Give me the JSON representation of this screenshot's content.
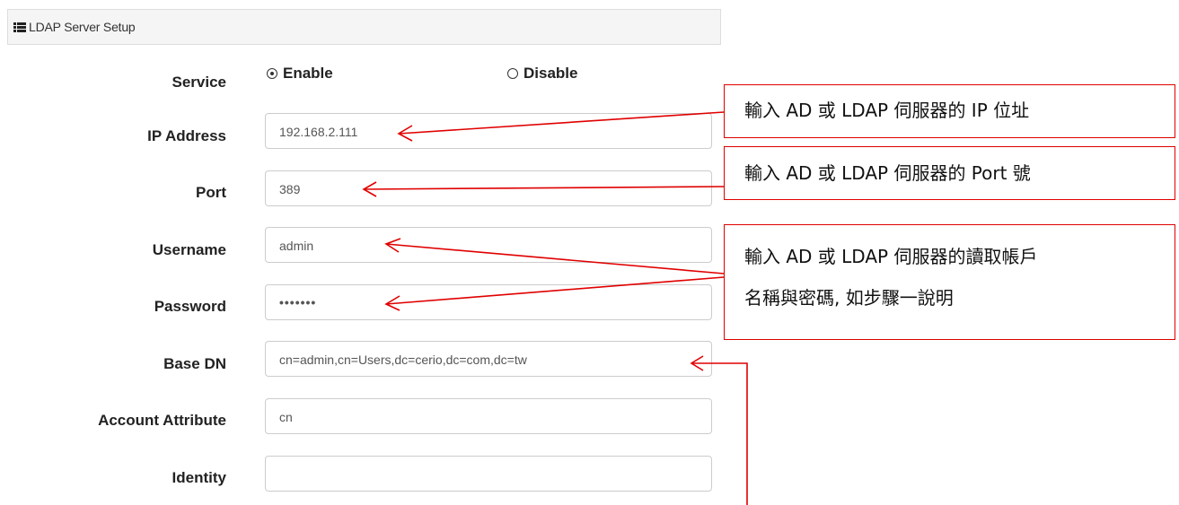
{
  "panel": {
    "title": "LDAP Server Setup"
  },
  "form": {
    "service": {
      "label": "Service",
      "options": [
        "Enable",
        "Disable"
      ],
      "selected": "Enable"
    },
    "ip_address": {
      "label": "IP Address",
      "value": "192.168.2.111"
    },
    "port": {
      "label": "Port",
      "value": "389"
    },
    "username": {
      "label": "Username",
      "value": "admin"
    },
    "password": {
      "label": "Password",
      "value": "•••••••"
    },
    "base_dn": {
      "label": "Base DN",
      "value": "cn=admin,cn=Users,dc=cerio,dc=com,dc=tw"
    },
    "account_attribute": {
      "label": "Account Attribute",
      "value": "cn"
    },
    "identity": {
      "label": "Identity",
      "value": ""
    }
  },
  "callouts": {
    "ip": "輸入 AD 或 LDAP  伺服器的 IP 位址",
    "port": "輸入 AD 或 LDAP  伺服器的 Port 號",
    "account_line1": "輸入 AD 或 LDAP  伺服器的讀取帳戶",
    "account_line2": "名稱與密碼, 如步驟一說明"
  },
  "colors": {
    "annotation": "#e00000",
    "header_bg": "#f5f5f5",
    "input_border": "#cccccc"
  }
}
